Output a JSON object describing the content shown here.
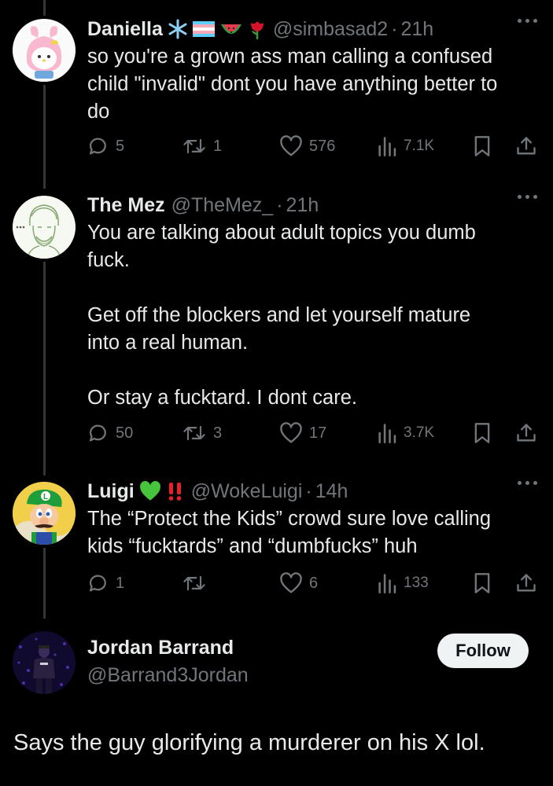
{
  "tweets": [
    {
      "name": "Daniella",
      "handle": "@simbasad2",
      "time": "21h",
      "lines": [
        "so you're a grown ass man calling a confused",
        "child \"invalid\" dont you have anything better to",
        "do"
      ],
      "replies": "5",
      "reposts": "1",
      "likes": "576",
      "views": "7.1K",
      "emojis": [
        "snowflake-emoji",
        "trans-flag-emoji",
        "watermelon-emoji",
        "rose-emoji"
      ]
    },
    {
      "name": "The Mez",
      "handle": "@TheMez_",
      "time": "21h",
      "lines": [
        "You are talking about adult topics you dumb",
        "fuck.",
        "",
        "Get off the blockers and let yourself mature",
        "into a real human.",
        "",
        "Or stay a fucktard. I dont care."
      ],
      "replies": "50",
      "reposts": "3",
      "likes": "17",
      "views": "3.7K"
    },
    {
      "name": "Luigi",
      "handle": "@WokeLuigi",
      "time": "14h",
      "lines": [
        "The “Protect the Kids” crowd sure love calling",
        "kids “fucktards” and “dumbfucks” huh"
      ],
      "replies": "1",
      "reposts": "",
      "likes": "6",
      "views": "133",
      "emojis": [
        "green-heart-emoji",
        "double-exclamation-emoji"
      ]
    }
  ],
  "main_tweet": {
    "name": "Jordan Barrand",
    "handle": "@Barrand3Jordan",
    "follow_label": "Follow",
    "text": "Says the guy glorifying a murderer on his X lol."
  },
  "colors": {
    "background": "#000000",
    "text_primary": "#e7e9ea",
    "text_secondary": "#71767b",
    "thread_line": "#333639",
    "follow_bg": "#eff3f4"
  }
}
